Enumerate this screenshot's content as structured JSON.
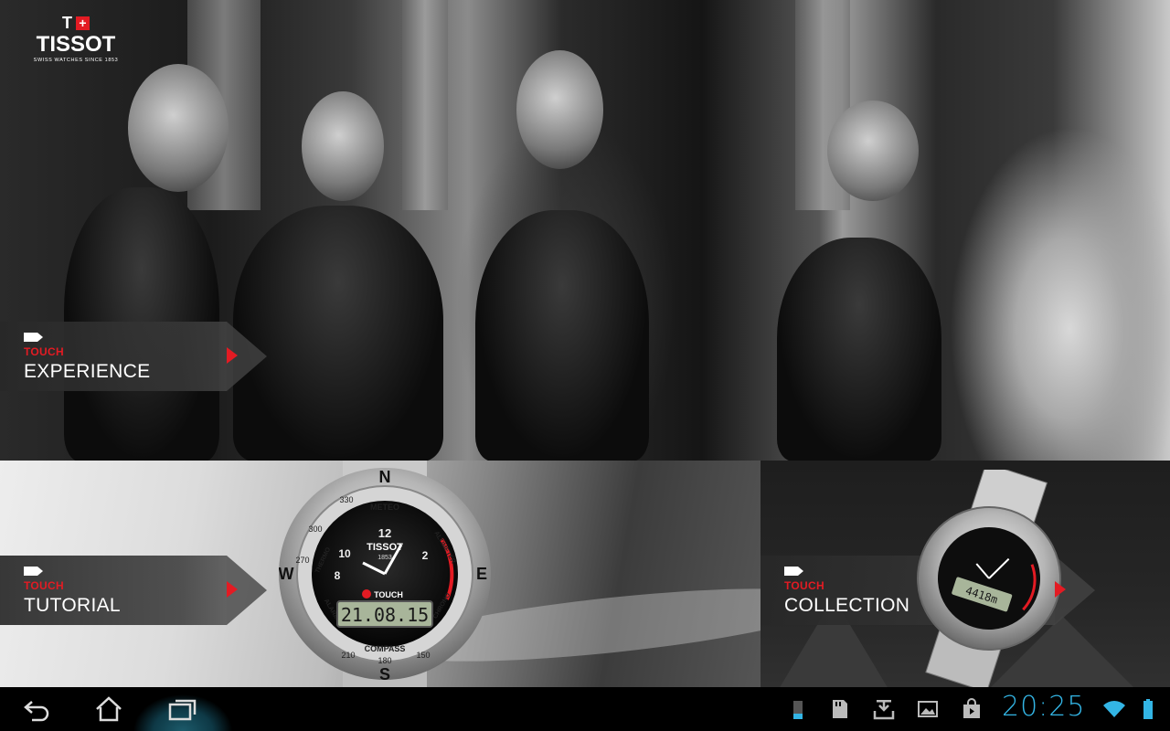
{
  "brand": {
    "logo_letter": "T",
    "logo_cross": "+",
    "logo_word": "TISSOT",
    "tagline": "SWISS WATCHES SINCE 1853"
  },
  "tabs": [
    {
      "small": "TOUCH",
      "label": "EXPERIENCE"
    },
    {
      "small": "TOUCH",
      "label": "TUTORIAL"
    },
    {
      "small": "TOUCH",
      "label": "COLLECTION"
    }
  ],
  "watch": {
    "brand": "TISSOT",
    "year": "1853",
    "model": "TOUCH",
    "display": "21.08.15",
    "top_label": "METEO",
    "bottom_label": "COMPASS",
    "left_label": "THERMO",
    "right_label": "ALTIMETER",
    "lower_left_label": "ALARM",
    "lower_right_label": "CHRONO",
    "north": "N",
    "south": "S",
    "east": "E",
    "west": "W",
    "bezel_330": "330",
    "bezel_300": "300",
    "bezel_270": "270",
    "bezel_210": "210",
    "bezel_180": "180",
    "bezel_150": "150",
    "dial_12": "12",
    "dial_10": "10",
    "dial_2": "2",
    "dial_8": "8"
  },
  "watch2": {
    "display": "4418m"
  },
  "system_bar": {
    "clock": "20:25",
    "accent": "#33b5e5"
  },
  "colors": {
    "brand_red": "#e31b23"
  }
}
